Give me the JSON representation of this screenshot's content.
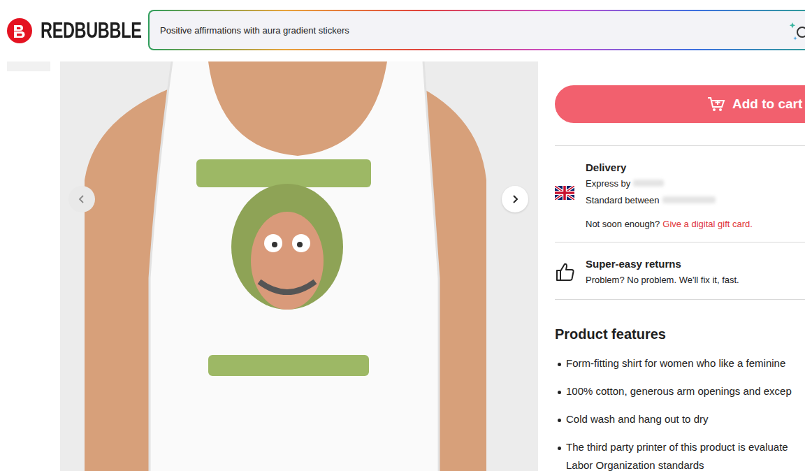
{
  "header": {
    "logo": "REDBUBBLE",
    "search": {
      "value": "Positive affirmations with aura gradient stickers"
    }
  },
  "cart_button": {
    "label": "Add to cart"
  },
  "delivery": {
    "title": "Delivery",
    "express": "Express by",
    "standard": "Standard between",
    "note": "Not soon enough?",
    "link": "Give a digital gift card."
  },
  "returns": {
    "title": "Super-easy returns",
    "text": "Problem? No problem. We'll fix it, fast."
  },
  "features": {
    "title": "Product features",
    "items": [
      {
        "lines": [
          "Form-fitting shirt for women who like a feminine"
        ]
      },
      {
        "lines": [
          "100% cotton, generous arm openings and excep"
        ]
      },
      {
        "lines": [
          "Cold wash and hang out to dry"
        ]
      },
      {
        "lines": [
          "The third party printer of this product is evaluate",
          "Labor Organization standards"
        ]
      }
    ]
  }
}
